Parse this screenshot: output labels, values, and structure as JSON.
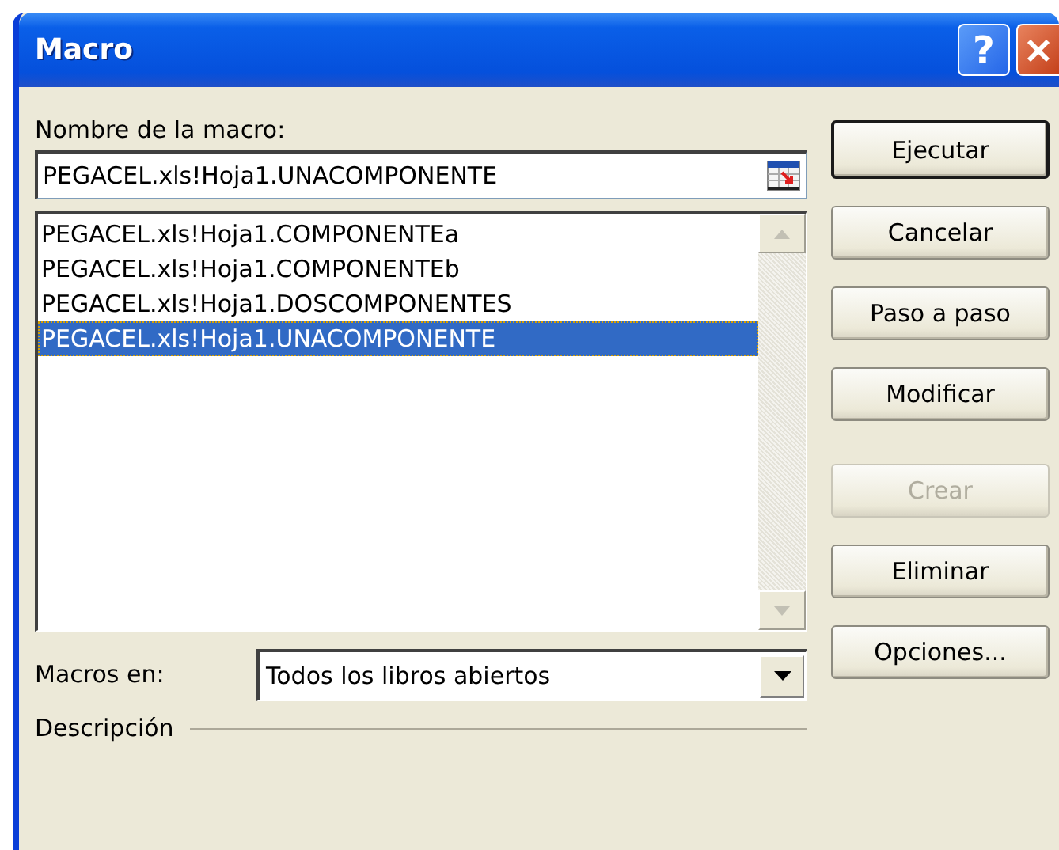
{
  "window": {
    "title": "Macro",
    "help_button": "?"
  },
  "macro_name": {
    "label": "Nombre de la macro:",
    "value": "PEGACEL.xls!Hoja1.UNACOMPONENTE"
  },
  "macros": [
    {
      "name": "PEGACEL.xls!Hoja1.COMPONENTEa",
      "selected": false
    },
    {
      "name": "PEGACEL.xls!Hoja1.COMPONENTEb",
      "selected": false
    },
    {
      "name": "PEGACEL.xls!Hoja1.DOSCOMPONENTES",
      "selected": false
    },
    {
      "name": "PEGACEL.xls!Hoja1.UNACOMPONENTE",
      "selected": true
    }
  ],
  "macros_in": {
    "label": "Macros en:",
    "value": "Todos los libros abiertos"
  },
  "description": {
    "label": "Descripción"
  },
  "buttons": [
    {
      "label": "Ejecutar",
      "default": true,
      "disabled": false
    },
    {
      "label": "Cancelar",
      "default": false,
      "disabled": false
    },
    {
      "label": "Paso a paso",
      "default": false,
      "disabled": false
    },
    {
      "label": "Modificar",
      "default": false,
      "disabled": false
    },
    {
      "label": "Crear",
      "default": false,
      "disabled": true
    },
    {
      "label": "Eliminar",
      "default": false,
      "disabled": false
    },
    {
      "label": "Opciones...",
      "default": false,
      "disabled": false
    }
  ]
}
